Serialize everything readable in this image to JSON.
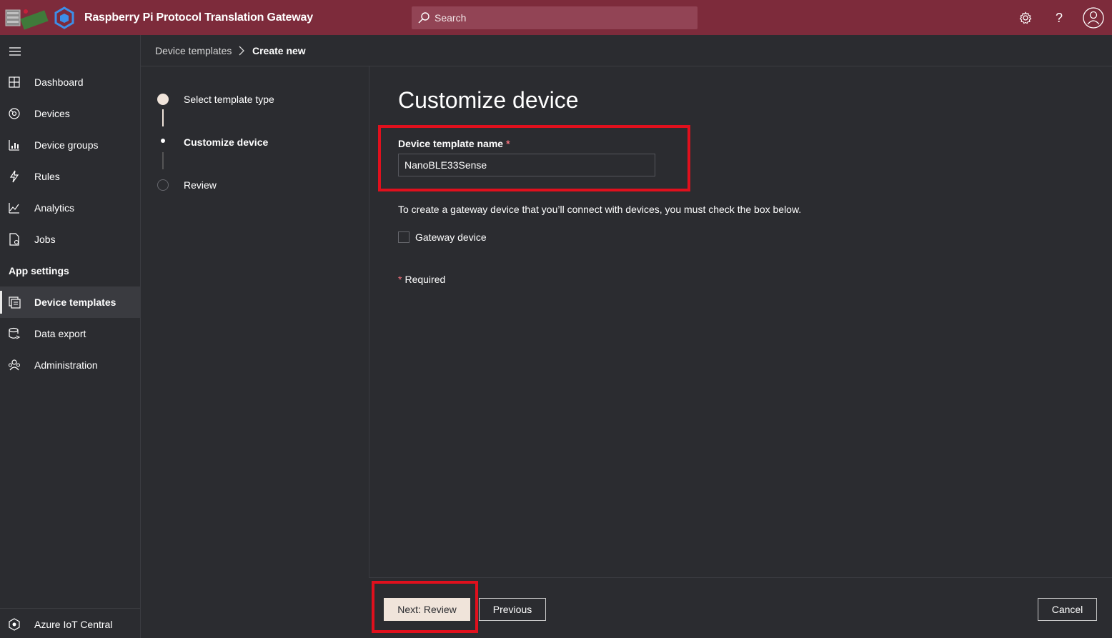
{
  "header": {
    "app_title": "Raspberry Pi Protocol Translation Gateway",
    "search_placeholder": "Search",
    "settings_icon": "gear-icon",
    "help_label": "?",
    "profile_icon": "user-icon",
    "background_color": "#7d2b3b"
  },
  "nav": {
    "items": [
      {
        "label": "Dashboard",
        "icon": "dashboard-icon"
      },
      {
        "label": "Devices",
        "icon": "devices-icon"
      },
      {
        "label": "Device groups",
        "icon": "device-groups-icon"
      },
      {
        "label": "Rules",
        "icon": "rules-icon"
      },
      {
        "label": "Analytics",
        "icon": "analytics-icon"
      },
      {
        "label": "Jobs",
        "icon": "jobs-icon"
      }
    ],
    "section_label": "App settings",
    "settings_items": [
      {
        "label": "Device templates",
        "icon": "device-templates-icon",
        "active": true
      },
      {
        "label": "Data export",
        "icon": "data-export-icon"
      },
      {
        "label": "Administration",
        "icon": "administration-icon"
      }
    ],
    "footer_label": "Azure IoT Central"
  },
  "breadcrumb": {
    "parent": "Device templates",
    "current": "Create new"
  },
  "steps": [
    {
      "label": "Select template type",
      "state": "completed"
    },
    {
      "label": "Customize device",
      "state": "current"
    },
    {
      "label": "Review",
      "state": "pending"
    }
  ],
  "main": {
    "title": "Customize device",
    "field_label": "Device template name",
    "required_marker": "*",
    "field_value": "NanoBLE33Sense",
    "info_text": "To create a gateway device that you’ll connect with devices, you must check the box below.",
    "checkbox_label": "Gateway device",
    "checkbox_checked": false,
    "required_note": "Required"
  },
  "footer": {
    "next_label": "Next: Review",
    "previous_label": "Previous",
    "cancel_label": "Cancel"
  },
  "colors": {
    "highlight": "#e0101d",
    "primary_button": "#f0e4da",
    "required": "#f1707b"
  }
}
